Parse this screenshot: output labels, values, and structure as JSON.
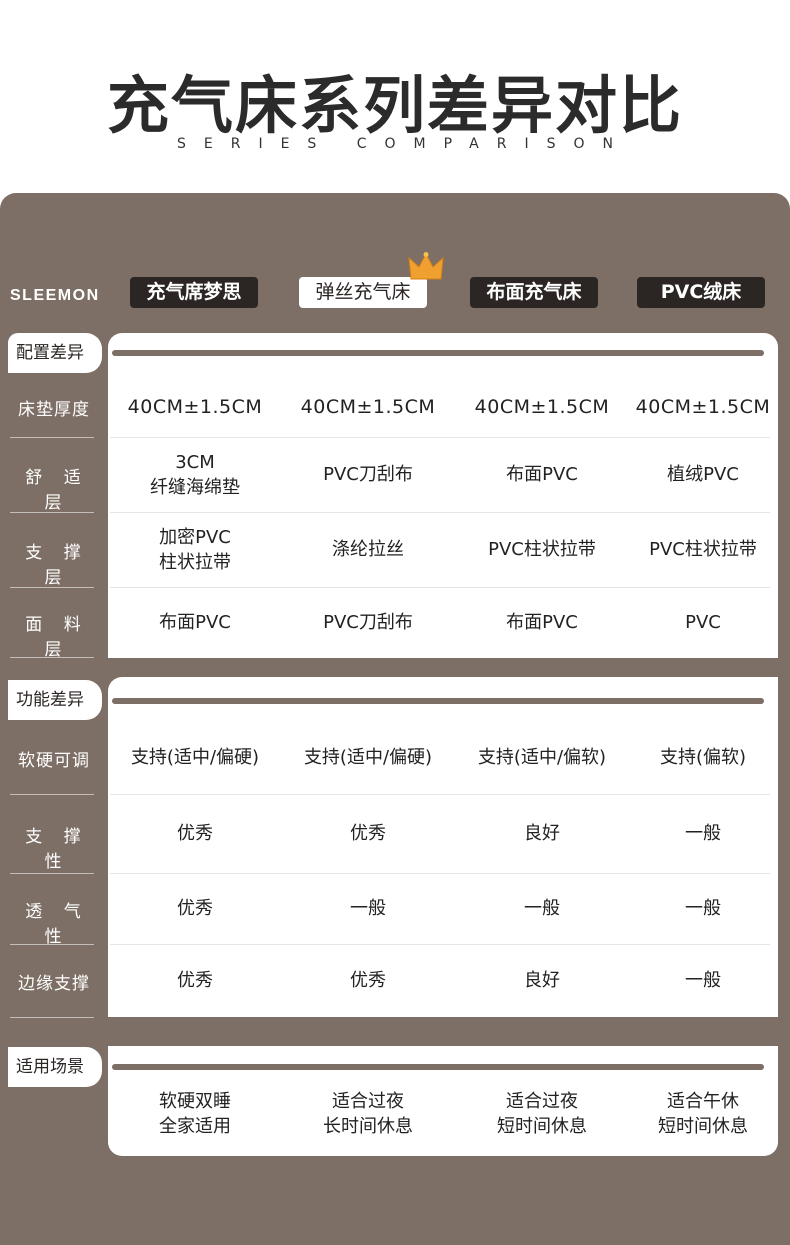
{
  "header": {
    "title": "充气床系列差异对比",
    "subtitle": "SERIES COMPARISON"
  },
  "brand": "SLEEMON",
  "products": [
    "充气席梦思",
    "弹丝充气床",
    "布面充气床",
    "PVC绒床"
  ],
  "featured_index": 1,
  "colors": {
    "panel": "#7d6f66",
    "dark_tag": "#2b2523",
    "crown": "#f0a030"
  },
  "sections": {
    "config": "配置差异",
    "function": "功能差异",
    "scene": "适用场景"
  },
  "config_rows": [
    {
      "label": "床垫厚度",
      "values": [
        "40CM±1.5CM",
        "40CM±1.5CM",
        "40CM±1.5CM",
        "40CM±1.5CM"
      ]
    },
    {
      "label": "舒 适 层",
      "values": [
        [
          "3CM",
          "纤缝海绵垫"
        ],
        [
          "PVC刀刮布"
        ],
        [
          "布面PVC"
        ],
        [
          "植绒PVC"
        ]
      ]
    },
    {
      "label": "支 撑 层",
      "values": [
        [
          "加密PVC",
          "柱状拉带"
        ],
        [
          "涤纶拉丝"
        ],
        [
          "PVC柱状拉带"
        ],
        [
          "PVC柱状拉带"
        ]
      ]
    },
    {
      "label": "面 料 层",
      "values": [
        [
          "布面PVC"
        ],
        [
          "PVC刀刮布"
        ],
        [
          "布面PVC"
        ],
        [
          "PVC"
        ]
      ]
    }
  ],
  "function_rows": [
    {
      "label": "软硬可调",
      "values": [
        "支持(适中/偏硬)",
        "支持(适中/偏硬)",
        "支持(适中/偏软)",
        "支持(偏软)"
      ]
    },
    {
      "label": "支 撑 性",
      "values": [
        "优秀",
        "优秀",
        "良好",
        "一般"
      ]
    },
    {
      "label": "透 气 性",
      "values": [
        "优秀",
        "一般",
        "一般",
        "一般"
      ]
    },
    {
      "label": "边缘支撑",
      "values": [
        "优秀",
        "优秀",
        "良好",
        "一般"
      ]
    }
  ],
  "scene_row": {
    "values": [
      [
        "软硬双睡",
        "全家适用"
      ],
      [
        "适合过夜",
        "长时间休息"
      ],
      [
        "适合过夜",
        "短时间休息"
      ],
      [
        "适合午休",
        "短时间休息"
      ]
    ]
  }
}
